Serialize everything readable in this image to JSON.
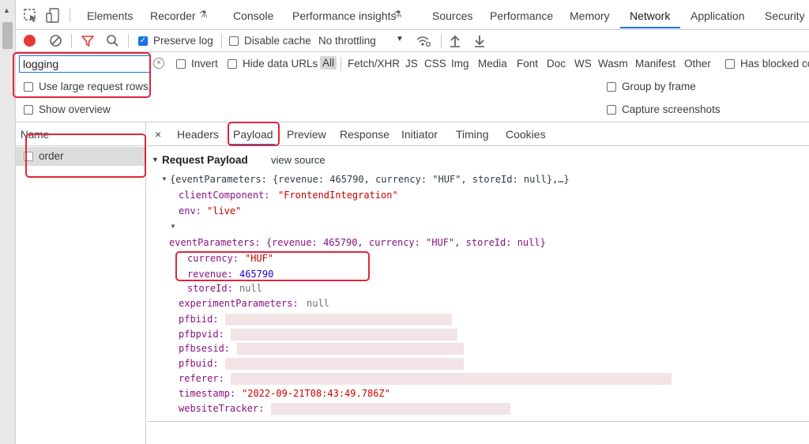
{
  "devtools_tabs": [
    "Elements",
    "Recorder",
    "Console",
    "Performance insights",
    "Sources",
    "Performance",
    "Memory",
    "Network",
    "Application",
    "Security"
  ],
  "active_tab": "Network",
  "toolbar": {
    "preserve_log": "Preserve log",
    "disable_cache": "Disable cache",
    "throttling": "No throttling"
  },
  "filter": {
    "value": "logging",
    "invert": "Invert",
    "hide_data_urls": "Hide data URLs",
    "types": [
      "All",
      "Fetch/XHR",
      "JS",
      "CSS",
      "Img",
      "Media",
      "Font",
      "Doc",
      "WS",
      "Wasm",
      "Manifest",
      "Other"
    ],
    "has_blocked": "Has blocked co"
  },
  "options": {
    "large_rows": "Use large request rows",
    "group_by_frame": "Group by frame",
    "show_overview": "Show overview",
    "capture_screenshots": "Capture screenshots"
  },
  "request_list": {
    "header": "Name",
    "rows": [
      "order"
    ]
  },
  "detail_tabs": [
    "×",
    "Headers",
    "Payload",
    "Preview",
    "Response",
    "Initiator",
    "Timing",
    "Cookies"
  ],
  "payload": {
    "section_title": "Request Payload",
    "view_source": "view source",
    "summary": "{eventParameters: {revenue: 465790, currency: \"HUF\", storeId: null},…}",
    "clientComponent_key": "clientComponent:",
    "clientComponent_val": "\"FrontendIntegration\"",
    "env_key": "env:",
    "env_val": "\"live\"",
    "eventParameters_line": "eventParameters: {revenue: 465790, currency: \"HUF\", storeId: null}",
    "currency_key": "currency:",
    "currency_val": "\"HUF\"",
    "revenue_key": "revenue:",
    "revenue_val": "465790",
    "storeId_key": "storeId:",
    "storeId_val": "null",
    "experimentParameters_key": "experimentParameters:",
    "experimentParameters_val": "null",
    "pfbiid_key": "pfbiid:",
    "pfbpvid_key": "pfbpvid:",
    "pfbsesid_key": "pfbsesid:",
    "pfbuid_key": "pfbuid:",
    "referer_key": "referer:",
    "timestamp_key": "timestamp:",
    "timestamp_val": "\"2022-09-21T08:43:49.786Z\"",
    "websiteTracker_key": "websiteTracker:"
  },
  "colors": {
    "highlight": "#e0263a",
    "accent": "#1a73e8",
    "record": "#e53935"
  }
}
